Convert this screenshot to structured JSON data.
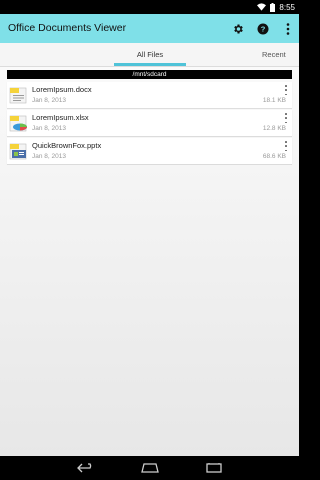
{
  "status_bar": {
    "time": "8:55",
    "wifi_icon": "wifi-icon",
    "battery_icon": "battery-icon"
  },
  "action_bar": {
    "title": "Office Documents Viewer",
    "icons": [
      "settings-icon",
      "help-icon",
      "overflow-menu-icon"
    ]
  },
  "tabs": [
    {
      "label": "All Files",
      "active": true
    },
    {
      "label": "Recent",
      "active": false
    }
  ],
  "path": "/mnt/sdcard",
  "files": [
    {
      "name": "LoremIpsum.docx",
      "date": "Jan 8, 2013",
      "size": "18.1 KB",
      "icon": "docx-file-icon"
    },
    {
      "name": "LoremIpsum.xlsx",
      "date": "Jan 8, 2013",
      "size": "12.8 KB",
      "icon": "xlsx-file-icon"
    },
    {
      "name": "QuickBrownFox.pptx",
      "date": "Jan 8, 2013",
      "size": "68.6 KB",
      "icon": "pptx-file-icon"
    }
  ],
  "nav_bar": {
    "icons": [
      "back-icon",
      "home-icon",
      "recent-apps-icon"
    ]
  },
  "colors": {
    "action_bar": "#7fe0e8",
    "tab_indicator": "#4fc3d8"
  }
}
